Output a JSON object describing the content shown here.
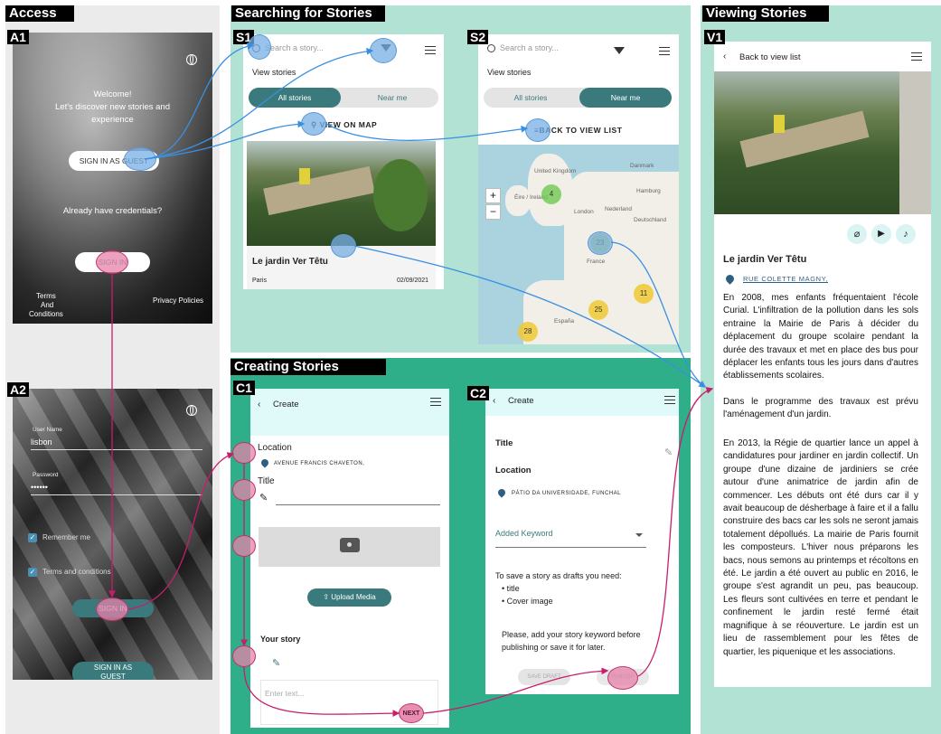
{
  "sections": {
    "access": "Access",
    "searching": "Searching for Stories",
    "viewing": "Viewing Stories",
    "creating": "Creating Stories"
  },
  "tags": {
    "a1": "A1",
    "a2": "A2",
    "s1": "S1",
    "s2": "S2",
    "v1": "V1",
    "c1": "C1",
    "c2": "C2"
  },
  "a1": {
    "welcome": "Welcome!",
    "line2": "Let's discover new stories and",
    "line3": "experience",
    "guest_btn": "SIGN IN AS GUEST",
    "credentials": "Already have credentials?",
    "signin": "SIGN IN",
    "terms1": "Terms",
    "terms2": "And",
    "terms3": "Conditions",
    "privacy": "Privacy Policies"
  },
  "a2": {
    "user_label": "User Name",
    "user_value": "lisbon",
    "pass_label": "Password",
    "pass_value": "••••••",
    "remember": "Remember me",
    "terms": "Terms and conditions",
    "signin": "SIGN IN",
    "guest1": "SIGN IN AS",
    "guest2": "GUEST"
  },
  "s1": {
    "search_placeholder": "Search a story...",
    "view_stories": "View stories",
    "tab_all": "All stories",
    "tab_near": "Near me",
    "view_map": "VIEW ON MAP",
    "story_title": "Le jardin Ver Têtu",
    "story_city": "Paris",
    "story_date": "02/09/2021"
  },
  "s2": {
    "search_placeholder": "Search a story...",
    "view_stories": "View stories",
    "tab_all": "All stories",
    "tab_near": "Near me",
    "back": "BACK TO VIEW LIST",
    "zoom_in": "+",
    "zoom_out": "−",
    "map_labels": {
      "uk": "United Kingdom",
      "danmark": "Danmark",
      "eire": "Éire / Ireland",
      "hamburg": "Hamburg",
      "london": "London",
      "nederland": "Nederland",
      "deutschland": "Deutschland",
      "france": "France",
      "espana": "España"
    },
    "clusters": [
      "4",
      "23",
      "11",
      "25",
      "28"
    ]
  },
  "v1": {
    "back": "Back to view list",
    "title": "Le jardin Ver Têtu",
    "address": "RUE COLETTE MAGNY,",
    "p1": "En 2008, mes enfants fréquentaient l'école Curial. L'infiltration de la pollution dans les sols entraine la Mairie de Paris à décider du déplacement du groupe scolaire pendant la durée des travaux et met en place des bus pour déplacer les enfants tous les jours dans d'autres établissements scolaires.",
    "p2": "Dans le programme des travaux est prévu l'aménagement d'un jardin.",
    "p3": "En 2013, la Régie de quartier lance un appel à candidatures pour jardiner en jardin collectif. Un groupe d'une dizaine de jardiniers se crée autour d'une animatrice de jardin afin de commencer. Les débuts ont été durs car il y avait beaucoup de désherbage à faire et il a fallu construire des bacs car les sols ne seront jamais totalement dépollués. La mairie de Paris fournit les composteurs. L'hiver nous préparons les bacs, nous semons au printemps et récoltons en été. Le jardin a été ouvert au public en 2016, le groupe s'est agrandit un peu, pas beaucoup. Les fleurs sont cultivées en terre et pendant le confinement le jardin resté fermé était magnifique à se réouverture. Le jardin est un lieu de rassemblement pour les fêtes de quartier, les piquenique et les associations."
  },
  "c1": {
    "header": "Create",
    "location": "Location",
    "location_value": "AVENUE FRANCIS CHAVETON,",
    "title": "Title",
    "upload": "Upload Media",
    "your_story": "Your story",
    "placeholder": "Enter text...",
    "next": "NEXT"
  },
  "c2": {
    "header": "Create",
    "title": "Title",
    "location": "Location",
    "location_value": "PÁTIO DA UNIVERSIDADE, FUNCHAL",
    "keyword": "Added Keyword",
    "draft_note": "To save a story as drafts you need:",
    "bullet1": "title",
    "bullet2": "Cover image",
    "keyword_note1": "Please, add your story keyword before",
    "keyword_note2": "publishing or save it for later.",
    "save_draft": "SAVE DRAFT",
    "publish": "PUBLISH"
  },
  "colors": {
    "teal_dark": "#3b7a7c",
    "access_bg": "#ebebeb",
    "search_bg": "#b2e2d4",
    "create_bg": "#2fae8a",
    "header_bg": "#e0fafa",
    "blue_flow": "#3a8fe0",
    "pink_flow": "#c81d6c"
  }
}
